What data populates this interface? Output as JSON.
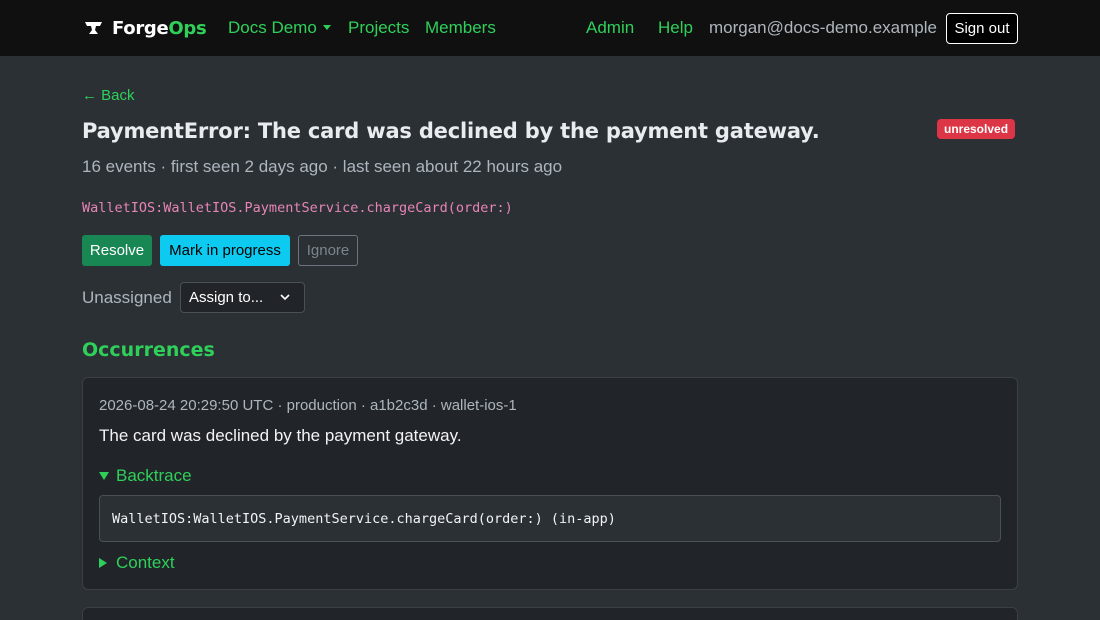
{
  "nav": {
    "brand_primary": "Forge",
    "brand_accent": "Ops",
    "project_menu": "Docs Demo",
    "projects": "Projects",
    "members": "Members",
    "admin": "Admin",
    "help": "Help",
    "user_email": "morgan@docs-demo.example",
    "sign_out": "Sign out"
  },
  "page": {
    "back": "← Back",
    "title": "PaymentError: The card was declined by the payment gateway.",
    "status": "unresolved",
    "meta": "16 events · first seen 2 days ago · last seen about 22 hours ago",
    "location": "WalletIOS:WalletIOS.PaymentService.chargeCard(order:)"
  },
  "actions": {
    "resolve": "Resolve",
    "in_progress": "Mark in progress",
    "ignore": "Ignore"
  },
  "assignment": {
    "label": "Unassigned",
    "select_value": "Assign to..."
  },
  "occurrences": {
    "heading": "Occurrences",
    "items": [
      {
        "meta": "2026-08-24 20:29:50 UTC · production · a1b2c3d · wallet-ios-1",
        "message": "The card was declined by the payment gateway.",
        "backtrace_label": "Backtrace",
        "backtrace_line": "WalletIOS:WalletIOS.PaymentService.chargeCard(order:) (in-app)",
        "context_label": "Context"
      }
    ]
  },
  "colors": {
    "accent": "#2fd05a",
    "danger": "#dc3545",
    "success": "#198754",
    "info": "#0dcaf0",
    "code": "#e685b5"
  },
  "icons": [
    "forge-anvil-icon",
    "chevron-down-icon",
    "caret-down-icon",
    "disclosure-open-icon",
    "disclosure-closed-icon"
  ]
}
